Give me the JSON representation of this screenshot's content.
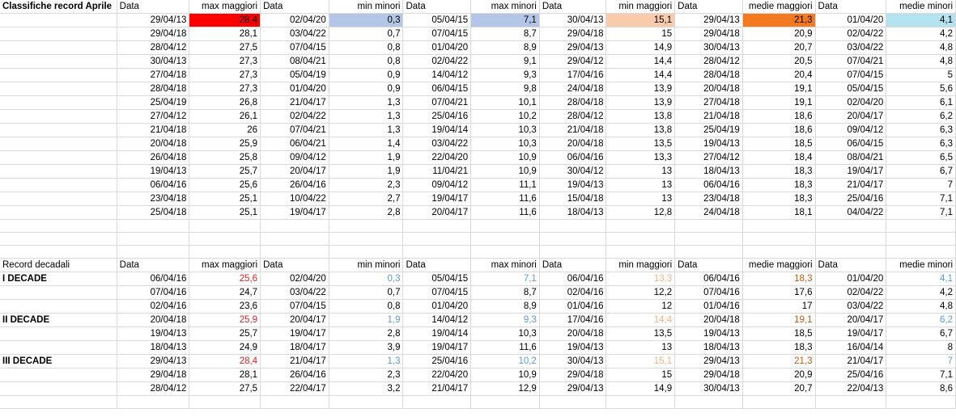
{
  "top": {
    "title": "Classifiche record Aprile",
    "headers": [
      "Data",
      "max maggiori",
      "Data",
      "min minori",
      "Data",
      "max minori",
      "Data",
      "min maggiori",
      "Data",
      "medie maggiori",
      "Data",
      "medie minori"
    ],
    "rows": [
      [
        "29/04/13",
        "28,4",
        "02/04/20",
        "0,3",
        "05/04/15",
        "7,1",
        "30/04/13",
        "15,1",
        "29/04/13",
        "21,3",
        "01/04/20",
        "4,1"
      ],
      [
        "29/04/18",
        "28,1",
        "03/04/22",
        "0,7",
        "07/04/15",
        "8,7",
        "29/04/18",
        "15",
        "29/04/18",
        "20,9",
        "02/04/22",
        "4,2"
      ],
      [
        "28/04/12",
        "27,5",
        "07/04/15",
        "0,8",
        "01/04/20",
        "8,9",
        "29/04/13",
        "14,9",
        "30/04/13",
        "20,7",
        "03/04/22",
        "4,8"
      ],
      [
        "30/04/13",
        "27,3",
        "08/04/21",
        "0,8",
        "02/04/22",
        "9,1",
        "29/04/12",
        "14,4",
        "28/04/12",
        "20,5",
        "07/04/21",
        "4,8"
      ],
      [
        "27/04/18",
        "27,3",
        "05/04/19",
        "0,9",
        "14/04/12",
        "9,3",
        "17/04/16",
        "14,4",
        "28/04/18",
        "20,4",
        "07/04/15",
        "5"
      ],
      [
        "28/04/18",
        "27,3",
        "01/04/20",
        "0,9",
        "06/04/15",
        "9,8",
        "24/04/18",
        "13,9",
        "20/04/18",
        "19,1",
        "05/04/15",
        "5,6"
      ],
      [
        "25/04/19",
        "26,8",
        "21/04/17",
        "1,3",
        "07/04/21",
        "10,1",
        "28/04/18",
        "13,9",
        "27/04/18",
        "19,1",
        "02/04/20",
        "6,1"
      ],
      [
        "27/04/12",
        "26,1",
        "02/04/22",
        "1,3",
        "25/04/16",
        "10,2",
        "28/04/12",
        "13,8",
        "21/04/18",
        "18,6",
        "20/04/17",
        "6,2"
      ],
      [
        "21/04/18",
        "26",
        "07/04/21",
        "1,3",
        "19/04/14",
        "10,3",
        "21/04/18",
        "13,8",
        "25/04/19",
        "18,6",
        "09/04/12",
        "6,3"
      ],
      [
        "20/04/18",
        "25,9",
        "06/04/21",
        "1,4",
        "03/04/22",
        "10,3",
        "20/04/18",
        "13,5",
        "19/04/13",
        "18,5",
        "06/04/15",
        "6,3"
      ],
      [
        "26/04/18",
        "25,8",
        "09/04/12",
        "1,9",
        "22/04/20",
        "10,9",
        "06/04/16",
        "13,3",
        "27/04/12",
        "18,4",
        "08/04/21",
        "6,5"
      ],
      [
        "19/04/13",
        "25,7",
        "20/04/17",
        "1,9",
        "11/04/21",
        "10,9",
        "30/04/12",
        "13",
        "18/04/13",
        "18,3",
        "19/04/17",
        "6,7"
      ],
      [
        "06/04/16",
        "25,6",
        "26/04/16",
        "2,3",
        "09/04/12",
        "11,1",
        "19/04/13",
        "13",
        "06/04/16",
        "18,3",
        "21/04/17",
        "7"
      ],
      [
        "23/04/18",
        "25,1",
        "10/04/22",
        "2,7",
        "19/04/17",
        "11,6",
        "15/04/18",
        "13",
        "23/04/18",
        "18,3",
        "25/04/16",
        "7,1"
      ],
      [
        "25/04/18",
        "25,1",
        "19/04/17",
        "2,8",
        "20/04/17",
        "11,6",
        "18/04/13",
        "12,8",
        "24/04/18",
        "18,1",
        "04/04/22",
        "7,1"
      ]
    ]
  },
  "decadal": {
    "title": "Record decadali",
    "headers": [
      "Data",
      "max maggiori",
      "Data",
      "min minori",
      "Data",
      "max minori",
      "Data",
      "min maggiori",
      "Data",
      "medie maggiori",
      "Data",
      "medie minori"
    ],
    "rows": [
      {
        "label": "I DECADE",
        "cells": [
          "06/04/16",
          "25,6",
          "02/04/20",
          "0,3",
          "05/04/15",
          "7,1",
          "06/04/16",
          "13,3",
          "06/04/16",
          "18,3",
          "01/04/20",
          "4,1"
        ],
        "highlight": true
      },
      {
        "label": "",
        "cells": [
          "07/04/16",
          "24,7",
          "03/04/22",
          "0,7",
          "07/04/15",
          "8,7",
          "02/04/16",
          "12,2",
          "07/04/16",
          "17,6",
          "02/04/22",
          "4,2"
        ],
        "highlight": false
      },
      {
        "label": "",
        "cells": [
          "02/04/16",
          "23,6",
          "07/04/15",
          "0,8",
          "01/04/20",
          "8,9",
          "01/04/16",
          "12",
          "01/04/16",
          "17",
          "03/04/22",
          "4,8"
        ],
        "highlight": false
      },
      {
        "label": "II DECADE",
        "cells": [
          "20/04/18",
          "25,9",
          "20/04/17",
          "1,9",
          "14/04/12",
          "9,3",
          "17/04/16",
          "14,4",
          "20/04/18",
          "19,1",
          "20/04/17",
          "6,2"
        ],
        "highlight": true
      },
      {
        "label": "",
        "cells": [
          "19/04/13",
          "25,7",
          "19/04/17",
          "2,8",
          "19/04/14",
          "10,3",
          "20/04/18",
          "13,5",
          "19/04/13",
          "18,5",
          "19/04/17",
          "6,7"
        ],
        "highlight": false
      },
      {
        "label": "",
        "cells": [
          "18/04/13",
          "24,9",
          "18/04/17",
          "3,9",
          "19/04/17",
          "11,6",
          "19/04/13",
          "13",
          "18/04/13",
          "18,3",
          "16/04/14",
          "8"
        ],
        "highlight": false
      },
      {
        "label": "III DECADE",
        "cells": [
          "29/04/13",
          "28,4",
          "21/04/17",
          "1,3",
          "25/04/16",
          "10,2",
          "30/04/13",
          "15,1",
          "29/04/13",
          "21,3",
          "21/04/17",
          "7"
        ],
        "highlight": true
      },
      {
        "label": "",
        "cells": [
          "29/04/18",
          "28,1",
          "26/04/16",
          "2,3",
          "22/04/20",
          "10,9",
          "29/04/18",
          "15",
          "29/04/18",
          "20,9",
          "25/04/16",
          "7,1"
        ],
        "highlight": false
      },
      {
        "label": "",
        "cells": [
          "28/04/12",
          "27,5",
          "22/04/17",
          "3,2",
          "21/04/17",
          "12,9",
          "29/04/13",
          "14,9",
          "30/04/13",
          "20,7",
          "22/04/13",
          "8,6"
        ],
        "highlight": false
      }
    ]
  },
  "colors": {
    "max_maggiori_fill": "#ff0000",
    "min_minori_fill": "#b4c6e7",
    "max_minori_fill": "#b4c6e7",
    "min_maggiori_fill": "#f8cbad",
    "medie_maggiori_fill": "#f47a1f",
    "medie_minori_fill": "#b3e3ee",
    "decadal_red_text": "#e02020",
    "decadal_blue_text": "#5b9bd5",
    "decadal_peach_text": "#f4b183",
    "decadal_orange_text": "#c55a11"
  }
}
